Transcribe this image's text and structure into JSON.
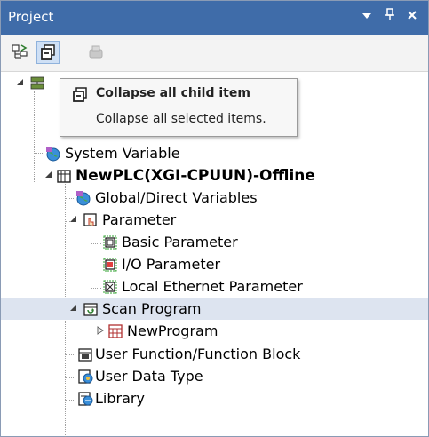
{
  "panel": {
    "title": "Project",
    "dropdown_icon": "▼",
    "pin_icon": "ᵖ",
    "close_icon": "×"
  },
  "toolbar": {
    "buttons": [
      {
        "name": "expand-tree-button",
        "icon": "tree-expand-icon",
        "active": false,
        "enabled": true
      },
      {
        "name": "collapse-all-button",
        "icon": "collapse-all-icon",
        "active": true,
        "enabled": true
      },
      {
        "name": "disabled-button",
        "icon": "disabled-icon",
        "active": false,
        "enabled": false
      }
    ]
  },
  "tooltip": {
    "title": "Collapse all child item",
    "description": "Collapse all selected items."
  },
  "tree": {
    "items": [
      {
        "label": "System Variable",
        "icon": "globe-variable-icon"
      },
      {
        "label": "NewPLC(XGI-CPUUN)-Offline",
        "icon": "plc-icon",
        "bold": true,
        "expanded": true
      },
      {
        "label": "Global/Direct Variables",
        "icon": "globe-variable-icon"
      },
      {
        "label": "Parameter",
        "icon": "parameter-icon",
        "expanded": true
      },
      {
        "label": "Basic Parameter",
        "icon": "basic-parameter-icon"
      },
      {
        "label": "I/O Parameter",
        "icon": "io-parameter-icon"
      },
      {
        "label": "Local Ethernet Parameter",
        "icon": "ethernet-parameter-icon"
      },
      {
        "label": "Scan Program",
        "icon": "scan-program-icon",
        "expanded": true,
        "selected": true
      },
      {
        "label": "NewProgram",
        "icon": "program-icon",
        "collapsed": true
      },
      {
        "label": "User Function/Function Block",
        "icon": "function-block-icon"
      },
      {
        "label": "User Data Type",
        "icon": "data-type-icon"
      },
      {
        "label": "Library",
        "icon": "library-icon"
      }
    ]
  },
  "colors": {
    "titlebar": "#3f6ca9",
    "selection": "#dde4f0",
    "toolbar": "#f3f3f3"
  }
}
